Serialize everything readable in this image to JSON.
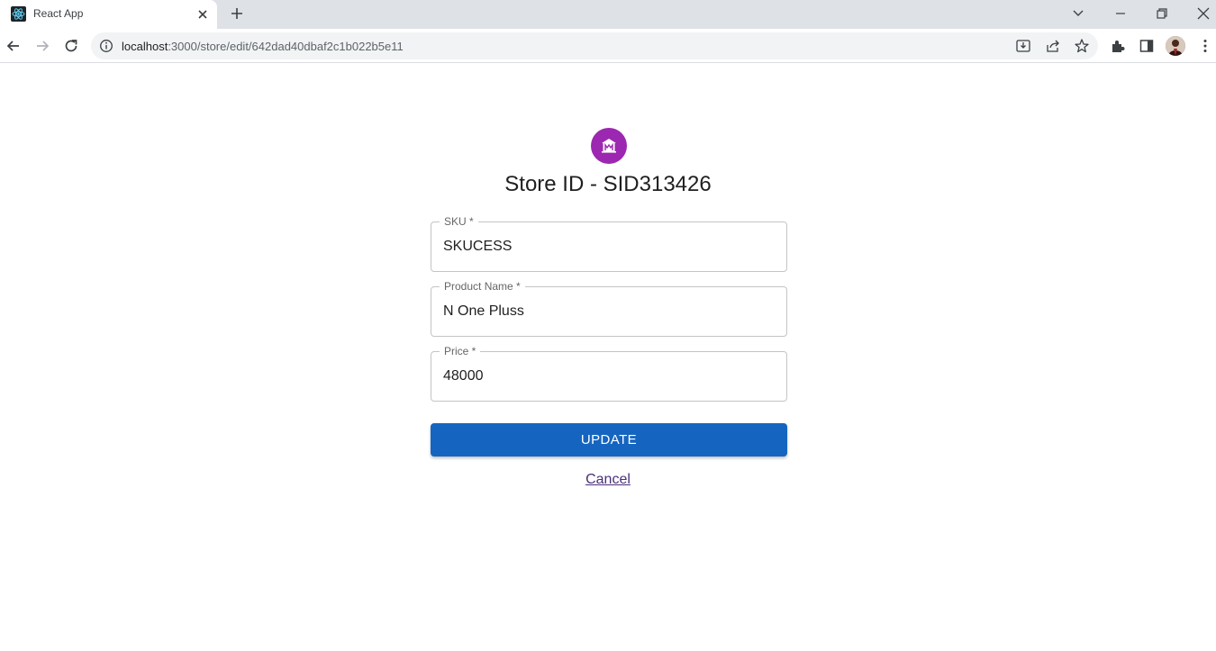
{
  "browser": {
    "tab_title": "React App",
    "url_host": "localhost",
    "url_path": ":3000/store/edit/642dad40dbaf2c1b022b5e11",
    "icons": [
      "react-favicon-icon",
      "close-icon",
      "plus-icon",
      "chevron-down-icon",
      "minimize-icon",
      "restore-icon",
      "close-window-icon",
      "back-arrow-icon",
      "forward-arrow-icon",
      "reload-icon",
      "info-icon",
      "install-icon",
      "share-icon",
      "star-icon",
      "puzzle-icon",
      "sidepanel-icon",
      "kebab-menu-icon"
    ]
  },
  "form": {
    "heading": "Store ID - SID313426",
    "sku_label": "SKU *",
    "sku_value": "SKUCESS",
    "product_label": "Product Name *",
    "product_value": "N One Pluss",
    "price_label": "Price *",
    "price_value": "48000",
    "update_label": "UPDATE",
    "cancel_label": "Cancel"
  },
  "colors": {
    "accent_purple": "#9c27b0",
    "button_blue": "#1565c0"
  }
}
